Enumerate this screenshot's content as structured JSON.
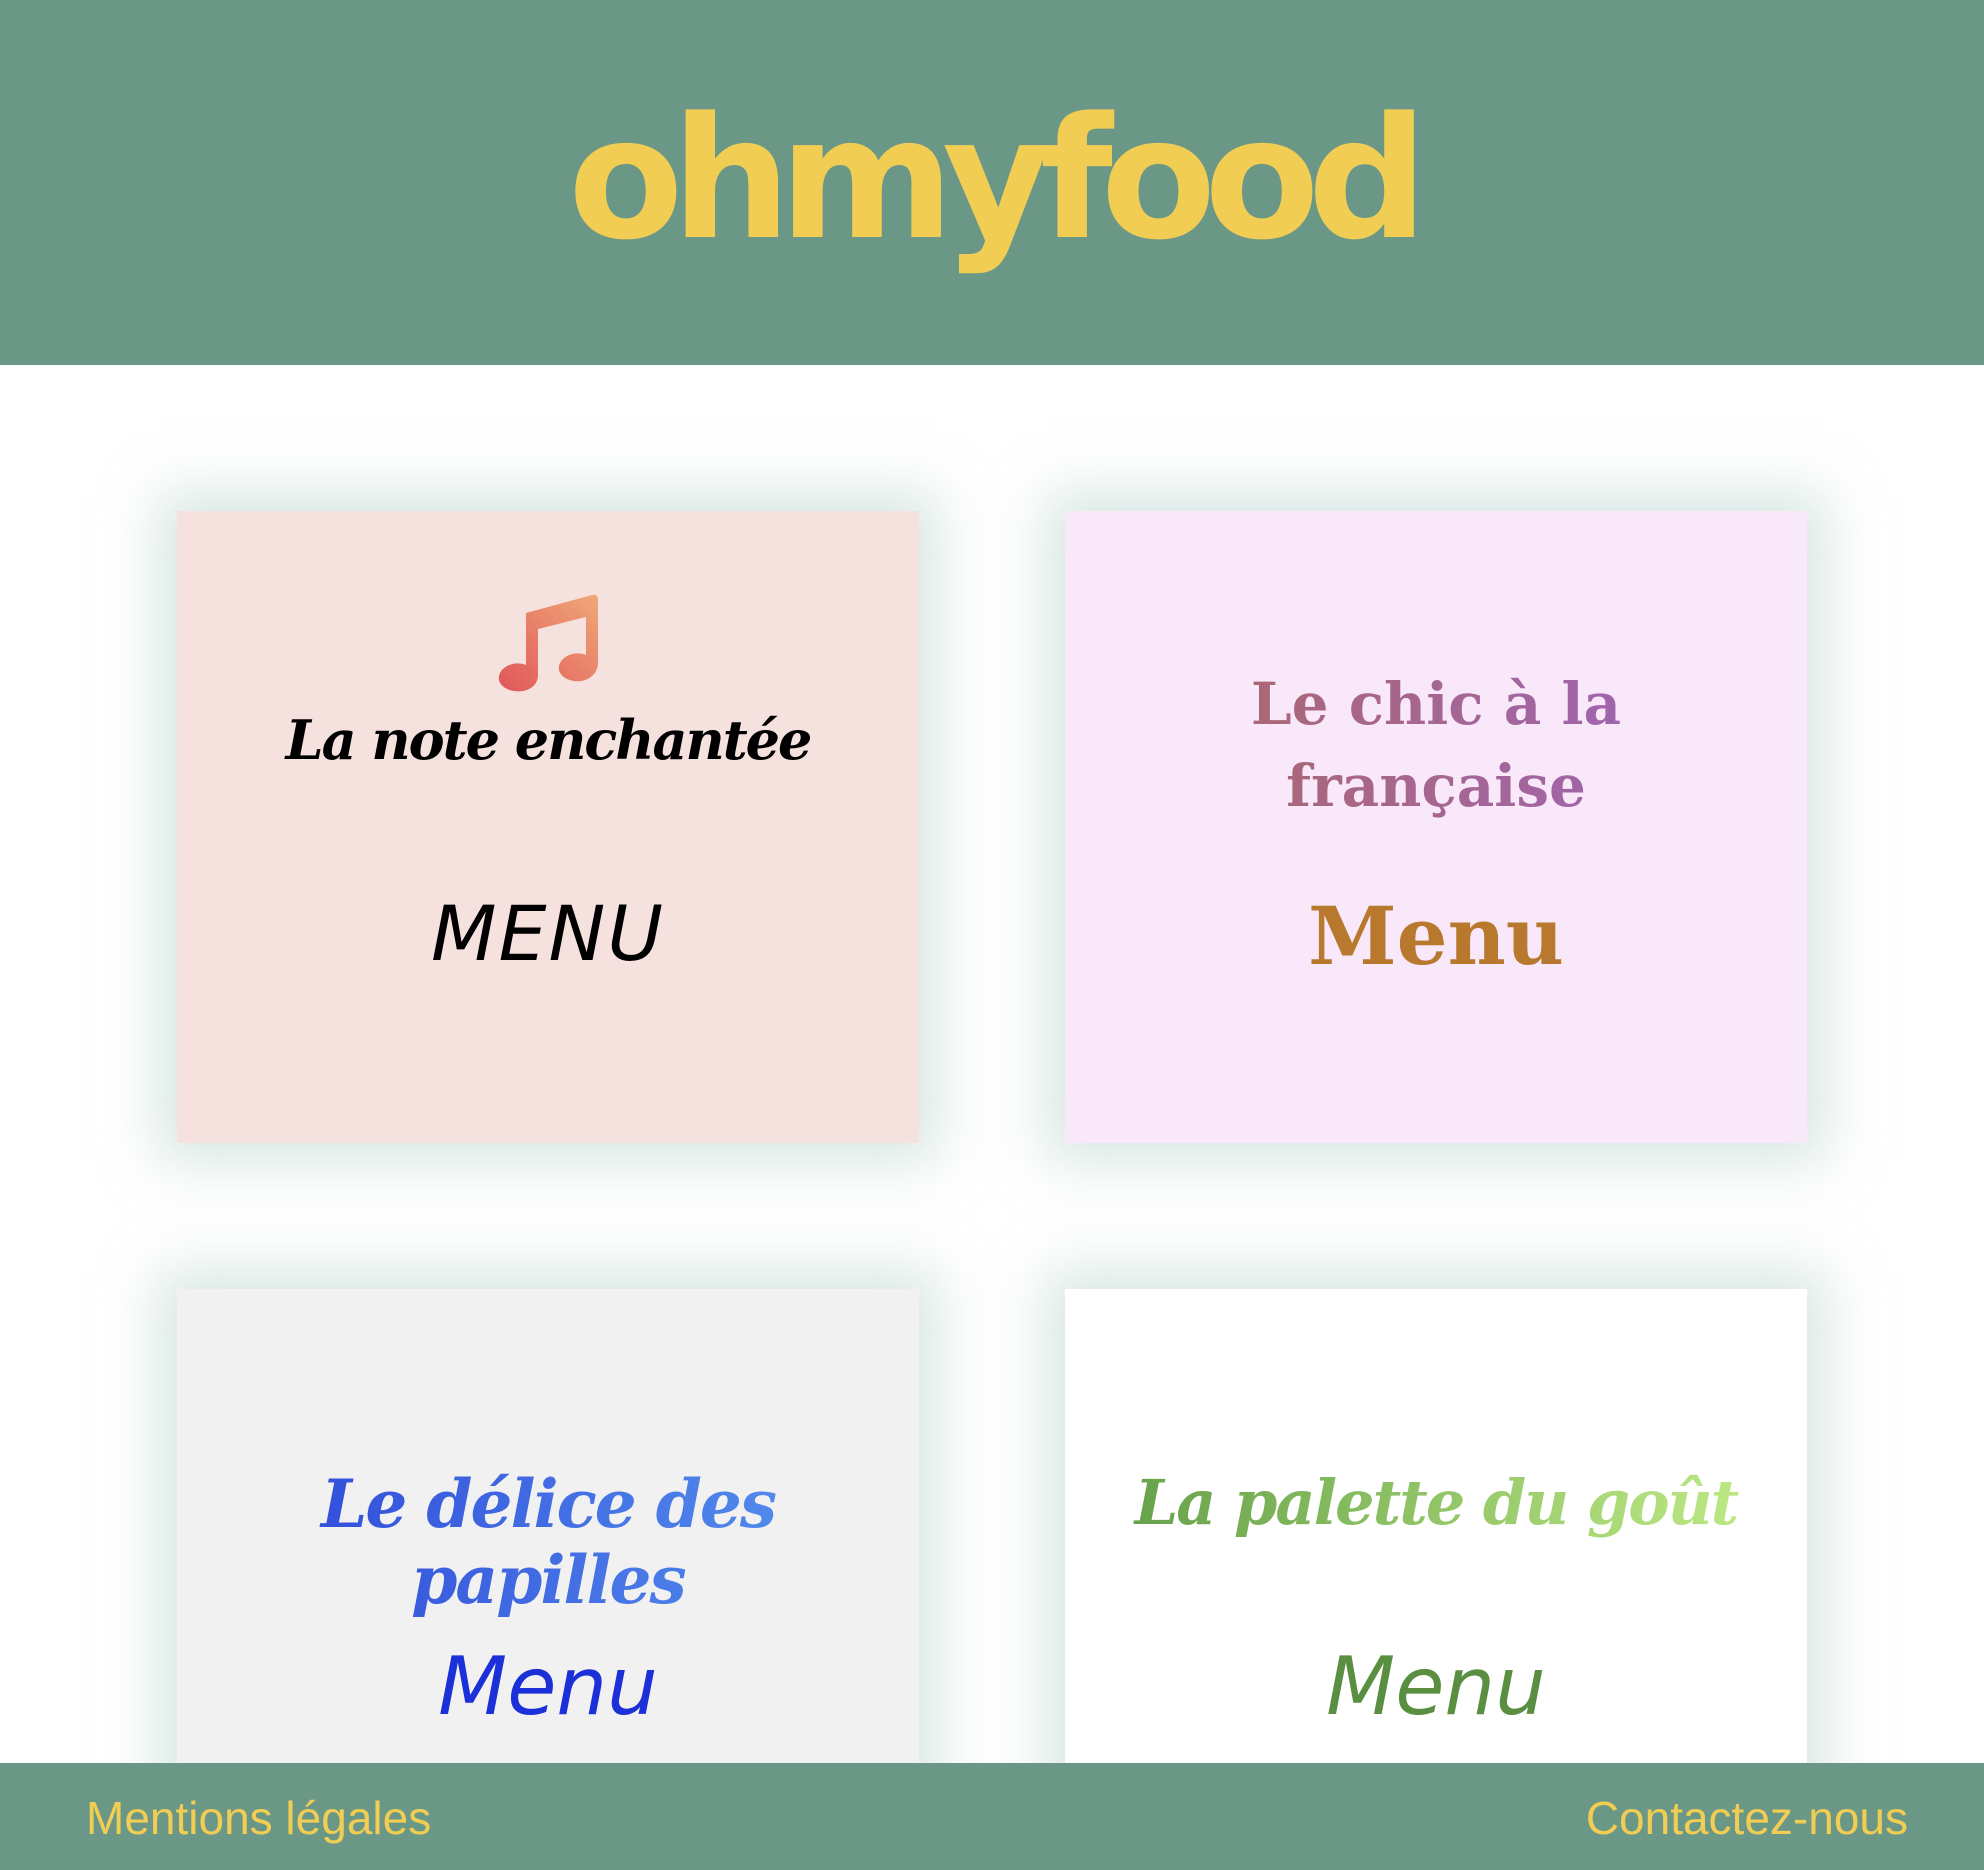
{
  "header": {
    "logo": "ohmyfood"
  },
  "restaurants": [
    {
      "name": "La note enchantée",
      "menu_label": "MENU",
      "icon": "music-note-icon"
    },
    {
      "name": "Le chic à la française",
      "menu_label": "Menu"
    },
    {
      "name": "Le délice des papilles",
      "menu_label": "Menu"
    },
    {
      "name": "La palette du goût",
      "menu_label": "Menu"
    }
  ],
  "footer": {
    "legal_label": "Mentions légales",
    "contact_label": "Contactez-nous"
  },
  "colors": {
    "header_bg": "#6b9886",
    "logo": "#f2cd54",
    "footer_link": "#f2cd54"
  }
}
